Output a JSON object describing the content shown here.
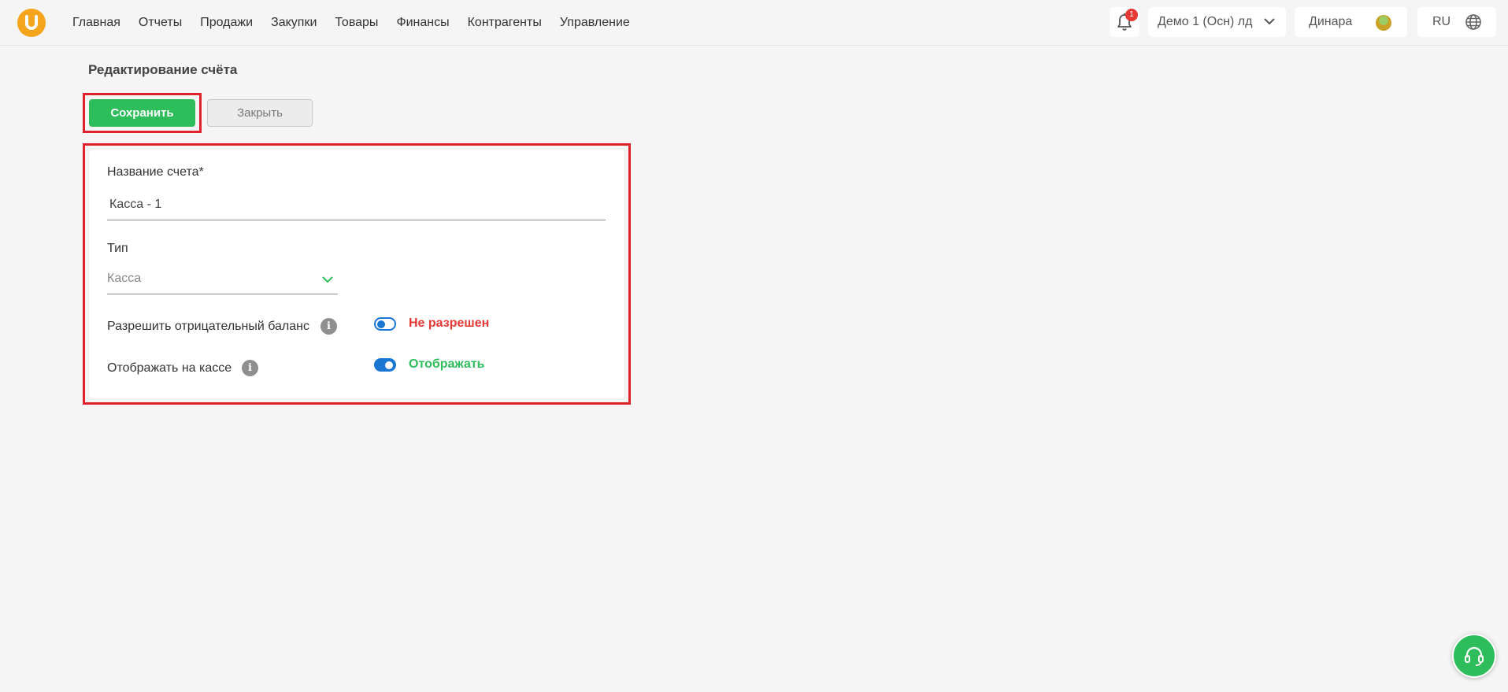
{
  "nav": {
    "items": [
      "Главная",
      "Отчеты",
      "Продажи",
      "Закупки",
      "Товары",
      "Финансы",
      "Контрагенты",
      "Управление"
    ]
  },
  "header": {
    "notifications_count": "1",
    "company": "Демо 1 (Осн) лд",
    "user": "Динара",
    "language": "RU"
  },
  "page": {
    "title": "Редактирование счёта",
    "save_label": "Сохранить",
    "close_label": "Закрыть"
  },
  "form": {
    "name_label": "Название счета*",
    "name_value": "Касса - 1",
    "type_label": "Тип",
    "type_value": "Касса",
    "negative_balance_label": "Разрешить отрицательный баланс",
    "negative_balance_status": "Не разрешен",
    "negative_balance_enabled": false,
    "show_at_cashier_label": "Отображать на кассе",
    "show_at_cashier_status": "Отображать",
    "show_at_cashier_enabled": true
  },
  "colors": {
    "accent_green": "#2dbd5a",
    "negative_red": "#e53935",
    "toggle_blue": "#1976d2",
    "logo_orange": "#f5a51c",
    "highlight_red": "#e0202a"
  },
  "icons": {
    "logo": "u-logo-icon",
    "notifications": "bell-icon",
    "company_dropdown": "chevron-down-icon",
    "language": "globe-icon",
    "info": "info-icon",
    "support": "headset-icon"
  }
}
